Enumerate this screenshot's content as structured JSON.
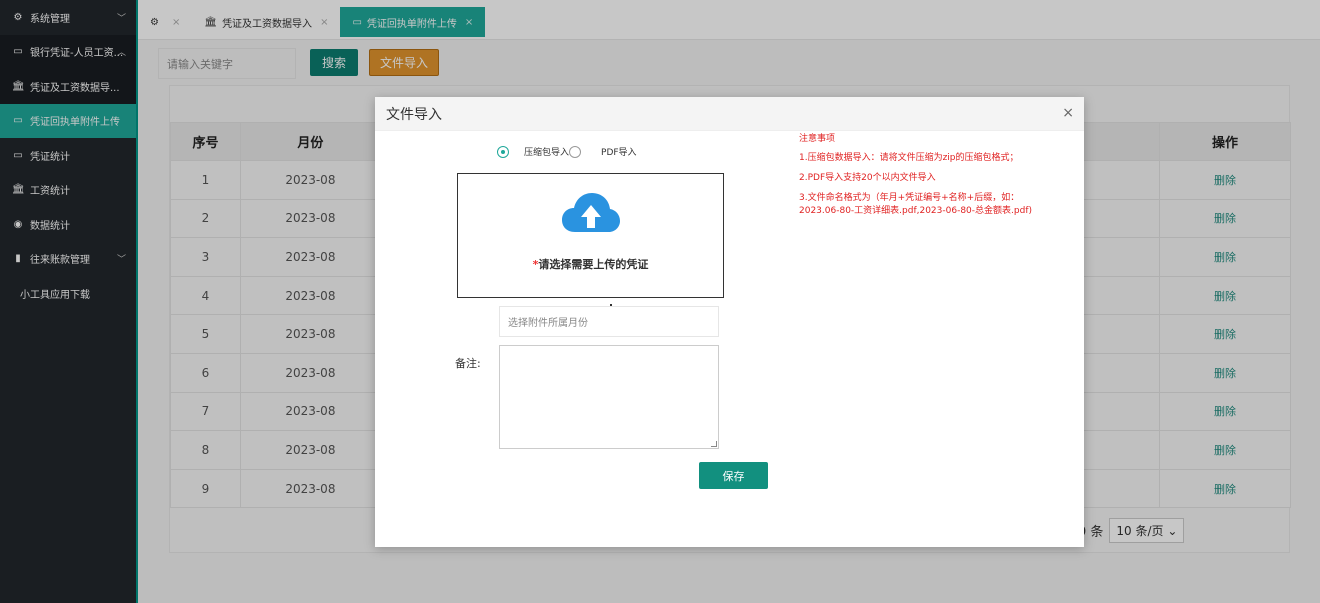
{
  "sidebar": {
    "items": [
      {
        "icon": "cogs-icon",
        "glyph": "⚙",
        "label": "系统管理",
        "chevron": "﹀"
      },
      {
        "icon": "card-icon",
        "glyph": "▭",
        "label": "银行凭证-人员工资...",
        "chevron": "︿"
      },
      {
        "icon": "bank-icon",
        "glyph": "🏛",
        "label": "凭证及工资数据导..."
      },
      {
        "icon": "inbox-icon",
        "glyph": "▭",
        "label": "凭证回执单附件上传"
      },
      {
        "icon": "card-icon",
        "glyph": "▭",
        "label": "凭证统计"
      },
      {
        "icon": "bank-icon",
        "glyph": "🏛",
        "label": "工资统计"
      },
      {
        "icon": "eye-icon",
        "glyph": "◉",
        "label": "数据统计"
      },
      {
        "icon": "book-icon",
        "glyph": "▮",
        "label": "往来账款管理",
        "chevron": "﹀"
      },
      {
        "label": "小工具应用下载"
      }
    ]
  },
  "tabs": [
    {
      "glyph": "⚙",
      "label": ""
    },
    {
      "glyph": "🏛",
      "label": "凭证及工资数据导入"
    },
    {
      "glyph": "▭",
      "label": "凭证回执单附件上传"
    }
  ],
  "toolbar": {
    "search_placeholder": "请输入关键字",
    "search_label": "搜索",
    "import_label": "文件导入"
  },
  "table": {
    "headers": [
      "序号",
      "月份",
      "操作"
    ],
    "rows": [
      {
        "no": "1",
        "month": "2023-08",
        "action": "删除"
      },
      {
        "no": "2",
        "month": "2023-08",
        "action": "删除"
      },
      {
        "no": "3",
        "month": "2023-08",
        "action": "删除"
      },
      {
        "no": "4",
        "month": "2023-08",
        "action": "删除"
      },
      {
        "no": "5",
        "month": "2023-08",
        "action": "删除"
      },
      {
        "no": "6",
        "month": "2023-08",
        "action": "删除"
      },
      {
        "no": "7",
        "month": "2023-08",
        "action": "删除"
      },
      {
        "no": "8",
        "month": "2023-08",
        "action": "删除"
      },
      {
        "no": "9",
        "month": "2023-08",
        "action": "删除"
      }
    ]
  },
  "pager": {
    "total_text": "9 条",
    "page_size": "10 条/页"
  },
  "modal": {
    "title": "文件导入",
    "close": "×",
    "radio_zip": "压缩包导入",
    "radio_pdf": "PDF导入",
    "upload_required": "*",
    "upload_text": "请选择需要上传的凭证",
    "month_placeholder": "选择附件所属月份",
    "remark_label": "备注:",
    "save_label": "保存",
    "notes_title": "注意事项",
    "notes": [
      "1.压缩包数据导入：请将文件压缩为zip的压缩包格式；",
      "2.PDF导入支持20个以内文件导入",
      "3.文件命名格式为（年月+凭证编号+名称+后缀，如：2023.06-80-工资详细表.pdf,2023-06-80-总金额表.pdf)"
    ]
  },
  "colors": {
    "accent": "#1fa89a",
    "sidebar_bg": "#22272c",
    "import_button": "#e0942e",
    "notes_red": "#e02222"
  }
}
